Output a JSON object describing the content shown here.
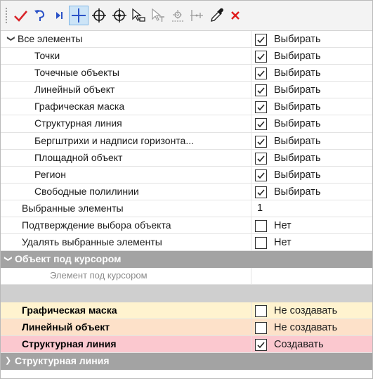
{
  "toolbar": {
    "buttons": [
      {
        "id": "apply",
        "icon": "checkmark-icon",
        "color": "#d9262b",
        "active": false
      },
      {
        "id": "undo",
        "icon": "undo-arrow-icon",
        "color": "#2b52c7",
        "active": false
      },
      {
        "id": "next",
        "icon": "skip-next-icon",
        "color": "#2b52c7",
        "active": false
      },
      {
        "id": "crosshair",
        "icon": "crosshair-icon",
        "color": "#2b52c7",
        "active": true
      },
      {
        "id": "target",
        "icon": "target-icon",
        "color": "#1a1a1a",
        "active": false
      },
      {
        "id": "target-dot",
        "icon": "target-dot-icon",
        "color": "#1a1a1a",
        "active": false
      },
      {
        "id": "select-object",
        "icon": "select-object-icon",
        "color": "#1a1a1a",
        "active": false
      },
      {
        "id": "select-text",
        "icon": "select-text-icon",
        "color": "#9a9a9a",
        "active": false
      },
      {
        "id": "snap-grid",
        "icon": "snap-grid-icon",
        "color": "#9a9a9a",
        "active": false
      },
      {
        "id": "vertex",
        "icon": "vertex-icon",
        "color": "#9a9a9a",
        "active": false
      },
      {
        "id": "eyedropper",
        "icon": "eyedropper-icon",
        "color": "#1a1a1a",
        "active": false
      },
      {
        "id": "close",
        "icon": "close-icon",
        "color": "#e01b1b",
        "active": false
      }
    ]
  },
  "colors": {
    "header_gray": "#a3a3a3",
    "blank_gray": "#cfcfcf",
    "row_yellow": "#fff3cf",
    "row_orange": "#fde1c9",
    "row_pink": "#fbc8cf",
    "toolbar_active": "#cce4f7"
  },
  "grid": {
    "all_elements": {
      "label": "Все элементы",
      "checked": true,
      "value": "Выбирать"
    },
    "items": [
      {
        "label": "Точки",
        "checked": true,
        "value": "Выбирать"
      },
      {
        "label": "Точечные объекты",
        "checked": true,
        "value": "Выбирать"
      },
      {
        "label": "Линейный объект",
        "checked": true,
        "value": "Выбирать"
      },
      {
        "label": "Графическая маска",
        "checked": true,
        "value": "Выбирать"
      },
      {
        "label": "Структурная линия",
        "checked": true,
        "value": "Выбирать"
      },
      {
        "label": "Бергштрихи и надписи горизонта...",
        "checked": true,
        "value": "Выбирать"
      },
      {
        "label": "Площадной объект",
        "checked": true,
        "value": "Выбирать"
      },
      {
        "label": "Регион",
        "checked": true,
        "value": "Выбирать"
      },
      {
        "label": "Свободные полилинии",
        "checked": true,
        "value": "Выбирать"
      }
    ],
    "selected_count": {
      "label": "Выбранные элементы",
      "value": "1"
    },
    "confirm_selection": {
      "label": "Подтверждение выбора объекта",
      "checked": false,
      "value": "Нет"
    },
    "delete_selected": {
      "label": "Удалять выбранные элементы",
      "checked": false,
      "value": "Нет"
    },
    "cursor_section": {
      "label": "Объект под курсором"
    },
    "element_under_cursor": {
      "label": "Элемент под курсором"
    },
    "create_rows": [
      {
        "label": "Графическая маска",
        "checked": false,
        "value": "Не создавать",
        "style": "yellow"
      },
      {
        "label": "Линейный объект",
        "checked": false,
        "value": "Не создавать",
        "style": "orange"
      },
      {
        "label": "Структурная линия",
        "checked": true,
        "value": "Создавать",
        "style": "pink"
      }
    ],
    "last_section": {
      "label": "Структурная линия"
    }
  }
}
